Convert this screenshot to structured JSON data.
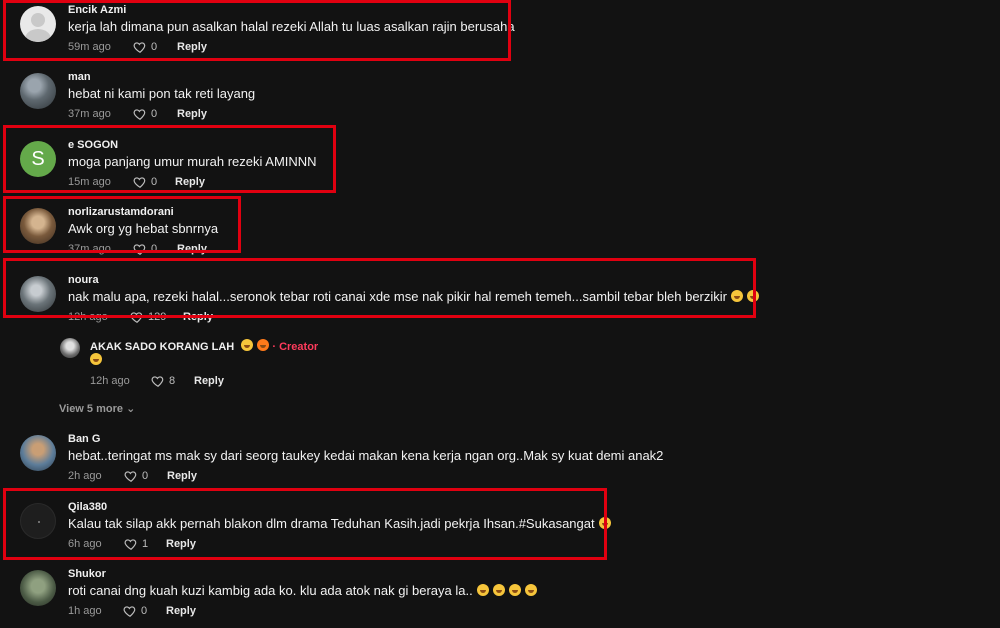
{
  "comments": [
    {
      "username": "Encik Azmi",
      "text": "kerja lah dimana pun asalkan halal rezeki Allah tu luas asalkan rajin berusaha",
      "time": "59m ago",
      "likes": "0",
      "reply": "Reply"
    },
    {
      "username": "man",
      "text": "hebat ni kami pon tak reti layang",
      "time": "37m ago",
      "likes": "0",
      "reply": "Reply"
    },
    {
      "username": "e SOGON",
      "avatar_letter": "S",
      "text": "moga panjang umur murah rezeki AMINNN",
      "time": "15m ago",
      "likes": "0",
      "reply": "Reply"
    },
    {
      "username": "norlizarustamdorani",
      "text": "Awk org yg hebat sbnrnya",
      "time": "37m ago",
      "likes": "0",
      "reply": "Reply"
    },
    {
      "username": "noura",
      "text": "nak malu apa, rezeki halal...seronok tebar roti canai xde mse nak pikir hal remeh temeh...sambil tebar bleh berzikir",
      "time": "12h ago",
      "likes": "129",
      "reply": "Reply"
    },
    {
      "username": "Ban G",
      "text": "hebat..teringat ms mak sy dari seorg taukey kedai makan kena kerja ngan org..Mak sy kuat demi anak2",
      "time": "2h ago",
      "likes": "0",
      "reply": "Reply"
    },
    {
      "username": "Qila380",
      "text": "Kalau tak silap akk pernah blakon dlm drama Teduhan Kasih.jadi pekrja Ihsan.#Sukasangat",
      "time": "6h ago",
      "likes": "1",
      "reply": "Reply"
    },
    {
      "username": "Shukor",
      "text": "roti canai dng kuah kuzi kambig ada ko. klu ada atok nak gi beraya la..",
      "time": "1h ago",
      "likes": "0",
      "reply": "Reply"
    }
  ],
  "creator_reply": {
    "username": "AKAK SADO KORANG LAH",
    "creator_label": "· Creator",
    "time": "12h ago",
    "likes": "8",
    "reply": "Reply"
  },
  "view_more": "View 5 more",
  "colors": {
    "highlight": "#e00010",
    "creator": "#ff3b5c",
    "background": "#121212"
  }
}
